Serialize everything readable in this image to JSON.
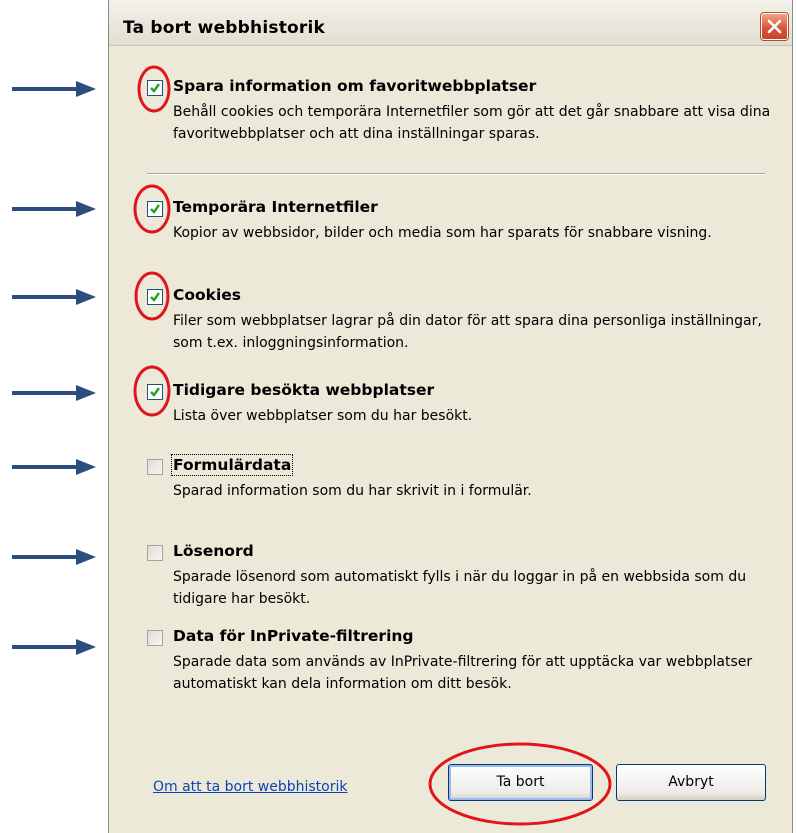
{
  "dialog": {
    "title": "Ta bort webbhistorik"
  },
  "items": [
    {
      "title": "Spara information om favoritwebbplatser",
      "description": "Behåll cookies och temporära Internetfiler som gör att det går snabbare att visa dina favoritwebbplatser och att dina inställningar sparas.",
      "checked": true
    },
    {
      "title": "Temporära Internetfiler",
      "description": "Kopior av webbsidor, bilder och media som har sparats för snabbare visning.",
      "checked": true
    },
    {
      "title": "Cookies",
      "description": "Filer som webbplatser lagrar på din dator för att spara dina personliga inställningar, som t.ex. inloggningsinformation.",
      "checked": true
    },
    {
      "title": "Tidigare besökta webbplatser",
      "description": "Lista över webbplatser som du har besökt.",
      "checked": true
    },
    {
      "title": "Formulärdata",
      "description": "Sparad information som du har skrivit in i formulär.",
      "checked": false
    },
    {
      "title": "Lösenord",
      "description": "Sparade lösenord som automatiskt fylls i när du loggar in på en webbsida som du tidigare har besökt.",
      "checked": false
    },
    {
      "title": "Data för InPrivate-filtrering",
      "description": "Sparade data som används av InPrivate-filtrering för att upptäcka var webbplatser automatiskt kan dela information om ditt besök.",
      "checked": false
    }
  ],
  "footer": {
    "help_link": "Om att ta bort webbhistorik",
    "delete_button": "Ta bort",
    "cancel_button": "Avbryt"
  },
  "colors": {
    "dialog_bg": "#ECE9D8",
    "annotation_arrow": "#2C4E7F",
    "annotation_circle": "#E0161C",
    "link": "#0A44B8"
  },
  "icons": {
    "close": "close-icon",
    "check": "checkmark-icon",
    "arrow": "right-arrow-icon"
  }
}
